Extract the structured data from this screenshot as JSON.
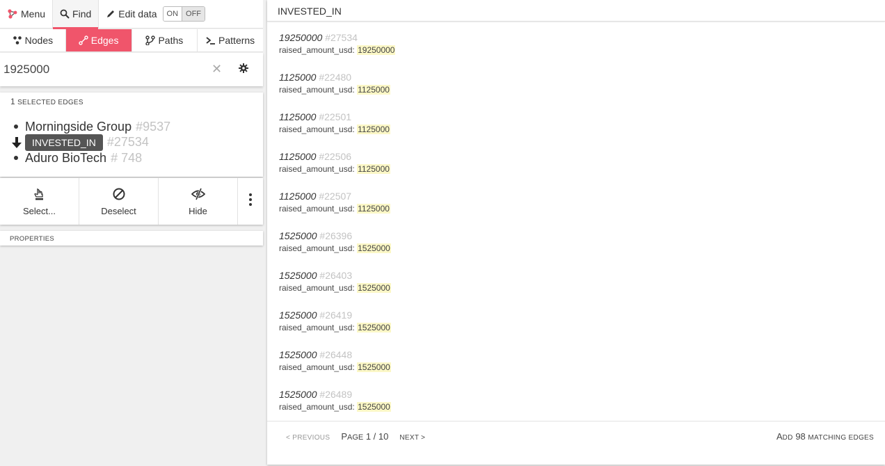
{
  "topbar": {
    "menu_label": "Menu",
    "find_label": "Find",
    "edit_label": "Edit data",
    "toggle_on": "ON",
    "toggle_off": "OFF"
  },
  "tabs": [
    {
      "label": "Nodes",
      "icon": "nodes-icon"
    },
    {
      "label": "Edges",
      "icon": "edges-icon",
      "active": true
    },
    {
      "label": "Paths",
      "icon": "paths-icon"
    },
    {
      "label": "Patterns",
      "icon": "terminal-icon"
    }
  ],
  "search": {
    "value": "1925000"
  },
  "selection": {
    "count": "1",
    "caption": "selected edges",
    "source": {
      "name": "Morningside Group",
      "id": "#9537"
    },
    "edge": {
      "type": "INVESTED_IN",
      "id": "#27534"
    },
    "target": {
      "name": "Aduro BioTech",
      "id": "# 748"
    }
  },
  "actions": {
    "select_label": "Select...",
    "deselect_label": "Deselect",
    "hide_label": "Hide"
  },
  "properties_caption": "Properties",
  "results": {
    "header": "INVESTED_IN",
    "property_name": "raised_amount_usd:",
    "items": [
      {
        "title": "19250000",
        "id": "#27534",
        "value": "19250000"
      },
      {
        "title": "1125000",
        "id": "#22480",
        "value": "1125000"
      },
      {
        "title": "1125000",
        "id": "#22501",
        "value": "1125000"
      },
      {
        "title": "1125000",
        "id": "#22506",
        "value": "1125000"
      },
      {
        "title": "1125000",
        "id": "#22507",
        "value": "1125000"
      },
      {
        "title": "1525000",
        "id": "#26396",
        "value": "1525000"
      },
      {
        "title": "1525000",
        "id": "#26403",
        "value": "1525000"
      },
      {
        "title": "1525000",
        "id": "#26419",
        "value": "1525000"
      },
      {
        "title": "1525000",
        "id": "#26448",
        "value": "1525000"
      },
      {
        "title": "1525000",
        "id": "#26489",
        "value": "1525000"
      }
    ]
  },
  "pager": {
    "prev": "< Previous",
    "page_word": "P",
    "page_rest": "age",
    "page_value": "1 / 10",
    "next": "Next >"
  },
  "add": {
    "first": "A",
    "rest": "dd",
    "count": "98",
    "suffix": "matching edges"
  },
  "colors": {
    "accent": "#f0556b",
    "highlight": "#fbf7c6",
    "chip": "#555555"
  }
}
